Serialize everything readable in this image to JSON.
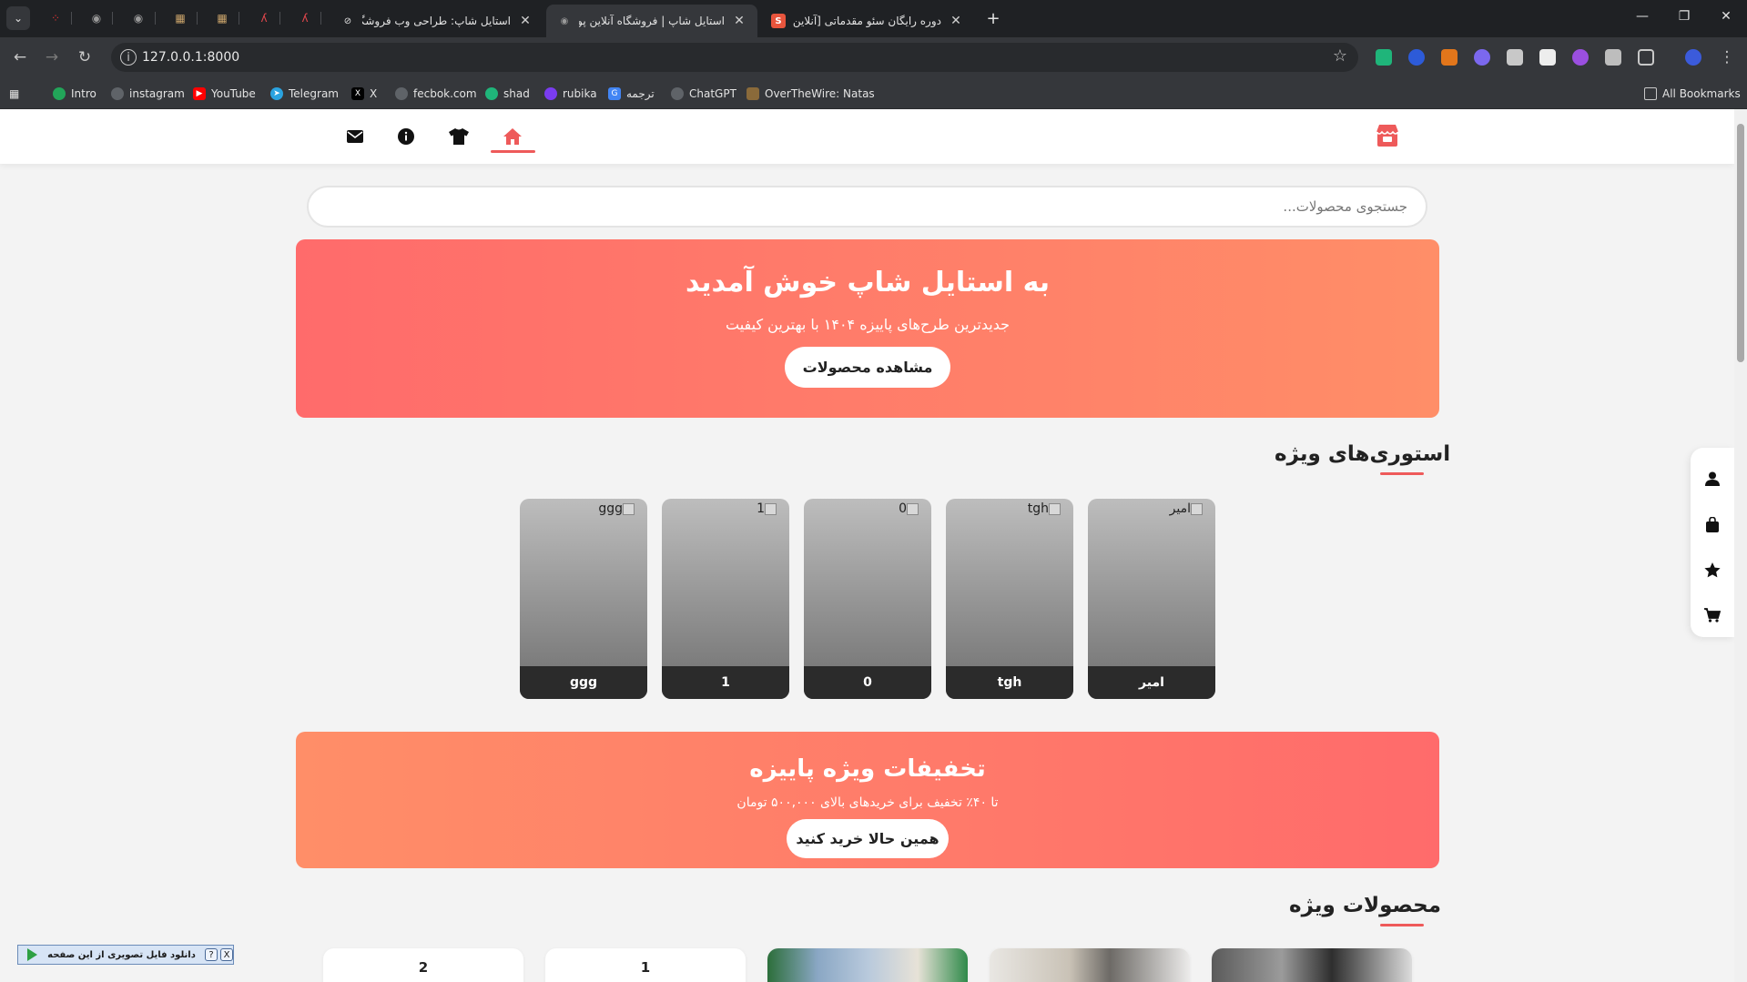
{
  "browser": {
    "tabs": [
      {
        "title": "استایل شاپ: طراحی وب فروشگاهی",
        "active": false
      },
      {
        "title": "استایل شاپ | فروشگاه آنلاین پوشاک",
        "active": true
      },
      {
        "title": "دوره رایگان سئو مقدماتی [آنلاین و",
        "active": false
      }
    ],
    "url": "127.0.0.1:8000",
    "bookmarks": [
      {
        "label": "Intro",
        "color": "#22a559"
      },
      {
        "label": "instagram",
        "color": "#5f6368"
      },
      {
        "label": "YouTube",
        "color": "#ff0000"
      },
      {
        "label": "Telegram",
        "color": "#2aa3e0"
      },
      {
        "label": "X",
        "color": "#000000"
      },
      {
        "label": "fecbok.com",
        "color": "#5f6368"
      },
      {
        "label": "shad",
        "color": "#1fb57a"
      },
      {
        "label": "rubika",
        "color": "#7a3cf0"
      },
      {
        "label": "ترجمه",
        "color": "#4285f4"
      },
      {
        "label": "ChatGPT",
        "color": "#5f6368"
      },
      {
        "label": "OverTheWire: Natas",
        "color": "#8a6a3a"
      }
    ],
    "all_bookmarks_label": "All Bookmarks"
  },
  "colors": {
    "accent": "#ee5a5a",
    "hero_from": "#ff6b6b",
    "hero_to": "#ff8e68",
    "story_label_bg": "#2b2b2b"
  },
  "header": {
    "icons": [
      "envelope-icon",
      "info-icon",
      "shirt-icon",
      "home-icon"
    ],
    "active": "home-icon",
    "brand_icon": "store-icon"
  },
  "search": {
    "placeholder": "جستجوی محصولات..."
  },
  "hero": {
    "title": "به استایل شاپ خوش آمدید",
    "subtitle": "جدیدترین طرح‌های پاییزه ۱۴۰۴ با بهترین کیفیت",
    "button": "مشاهده محصولات"
  },
  "stories": {
    "title": "استوری‌های ویژه",
    "items": [
      {
        "alt": "ggg",
        "label": "ggg"
      },
      {
        "alt": "1",
        "label": "1"
      },
      {
        "alt": "0",
        "label": "0"
      },
      {
        "alt": "tgh",
        "label": "tgh"
      },
      {
        "alt": "امیر",
        "label": "امیر"
      }
    ]
  },
  "promo": {
    "title": "تخفیفات ویژه پاییزه",
    "subtitle": "تا ۴۰٪ تخفیف برای خریدهای بالای ۵۰۰,۰۰۰ تومان",
    "button": "همین حالا خرید کنید"
  },
  "featured": {
    "title": "محصولات ویژه",
    "products": [
      {
        "label": "2"
      },
      {
        "label": "1"
      },
      {
        "label": ""
      },
      {
        "label": ""
      },
      {
        "label": ""
      }
    ]
  },
  "side_dock": {
    "icons": [
      "user-icon",
      "bag-icon",
      "star-icon",
      "cart-icon"
    ]
  },
  "download_bar": {
    "text": "دانلود فایل تصویری از این صفحه",
    "help": "?",
    "close": "X"
  }
}
